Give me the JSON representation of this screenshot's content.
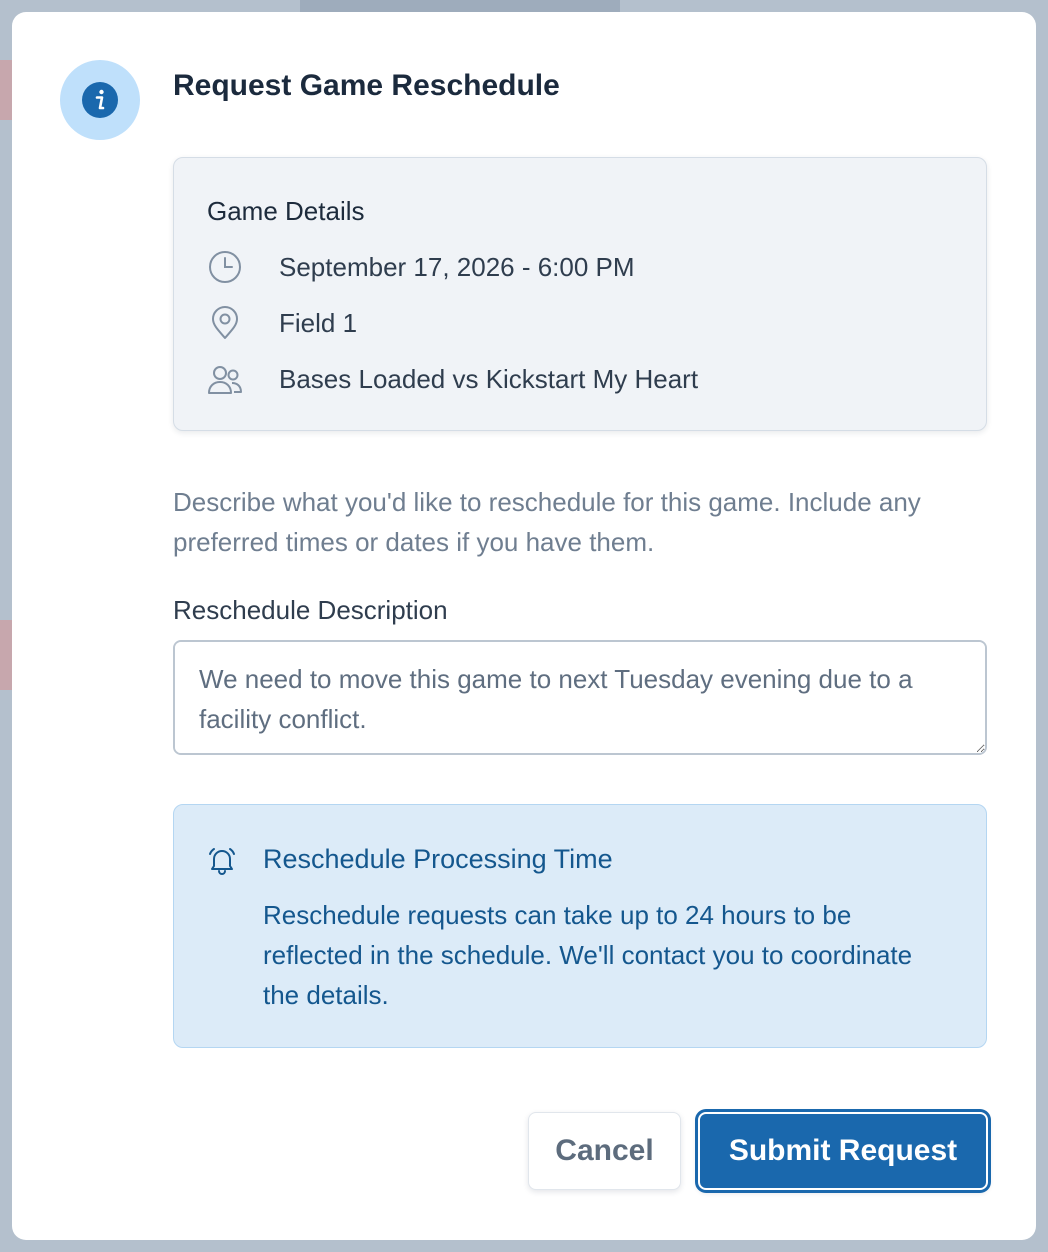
{
  "dialog": {
    "title": "Request Game Reschedule",
    "header_icon": "info-icon"
  },
  "game_details": {
    "heading": "Game Details",
    "date_time": "September 17, 2026 - 6:00 PM",
    "location": "Field 1",
    "matchup": "Bases Loaded vs Kickstart My Heart",
    "icons": [
      "clock-icon",
      "map-pin-icon",
      "users-icon"
    ]
  },
  "helper_text": "Describe what you'd like to reschedule for this game. Include any preferred times or dates if you have them.",
  "reschedule_field": {
    "label": "Reschedule Description",
    "value": "We need to move this game to next Tuesday evening due to a facility conflict."
  },
  "notice": {
    "icon": "bell-icon",
    "title": "Reschedule Processing Time",
    "body": "Reschedule requests can take up to 24 hours to be reflected in the schedule. We'll contact you to coordinate the details."
  },
  "actions": {
    "cancel_label": "Cancel",
    "submit_label": "Submit Request"
  },
  "colors": {
    "primary": "#1a68ad",
    "notice_bg": "#dcebf8",
    "notice_text": "#14578e",
    "icon_circle": "#bfe0fb"
  }
}
